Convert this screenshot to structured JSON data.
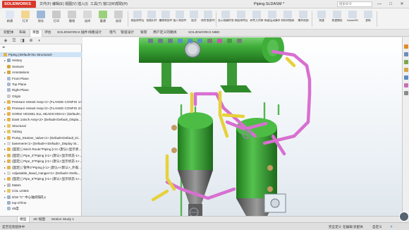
{
  "app": {
    "brand": "SOLIDWORKS",
    "document_title": "Piping.SLDASM *",
    "search_placeholder": "搜索命令",
    "menus": [
      "文件(F)",
      "编辑(E)",
      "视图(V)",
      "插入(I)",
      "工具(T)",
      "窗口(W)",
      "帮助(H)"
    ],
    "window_buttons": [
      "—",
      "□",
      "✕"
    ]
  },
  "ribbon": {
    "buttons": [
      {
        "label": "新建",
        "icon": "new-document-icon",
        "color": "#dfe7f2"
      },
      {
        "label": "打开",
        "icon": "open-folder-icon",
        "color": "#f2d690"
      },
      {
        "label": "保存",
        "icon": "save-icon",
        "color": "#9db7d8"
      },
      {
        "label": "打印",
        "icon": "print-icon",
        "color": "#c9c9c9"
      },
      {
        "label": "撤销",
        "icon": "undo-icon",
        "color": "#cfcfcf"
      },
      {
        "label": "选择",
        "icon": "select-arrow-icon",
        "color": "#d9d9d9"
      },
      {
        "label": "重建",
        "icon": "rebuild-icon",
        "color": "#9bd17c"
      },
      {
        "label": "选项",
        "icon": "gear-icon",
        "color": "#cfcfcf"
      }
    ],
    "left_group": [
      "装配体特征",
      "智能扣件",
      "编辑零部件",
      "插入零部件",
      "配合",
      "线性零部件阵列"
    ],
    "mid_group": [
      "显示隐藏的零部件",
      "装配体特征",
      "参考几何体",
      "新建运动算例",
      "材料明细表",
      "爆炸视图"
    ],
    "right_group": [
      "快速",
      "快速捕捉",
      "Instant3D",
      "更新"
    ]
  },
  "command_tabs": {
    "items": [
      "装配体",
      "布局",
      "草图",
      "评估",
      "SOLIDWORKS 插件",
      "线路设计",
      "电气",
      "管道设计",
      "钣管",
      "用户定义的路线",
      "SOLIDWORKS MBD"
    ],
    "active_index": 2
  },
  "panel_tabs": [
    "◈",
    "☰",
    "◨",
    "⊕",
    "◐"
  ],
  "tree": {
    "filter_icon": "filter-icon",
    "items": [
      {
        "label": "Piping  (Default<No Structural>",
        "level": 0,
        "icon": "assembly-icon",
        "color": "#e5b24a",
        "arrow": "",
        "selected": true
      },
      {
        "label": "History",
        "level": 1,
        "icon": "history-icon",
        "color": "#8fa7c1",
        "arrow": "▸"
      },
      {
        "label": "Sensors",
        "level": 1,
        "icon": "sensor-icon",
        "color": "#d4a640",
        "arrow": ""
      },
      {
        "label": "Annotations",
        "level": 1,
        "icon": "annotation-icon",
        "color": "#d4a640",
        "arrow": "▸"
      },
      {
        "label": "Front Plane",
        "level": 1,
        "icon": "plane-icon",
        "color": "#a8b9d0",
        "arrow": ""
      },
      {
        "label": "Top Plane",
        "level": 1,
        "icon": "plane-icon",
        "color": "#a8b9d0",
        "arrow": ""
      },
      {
        "label": "Right Plane",
        "level": 1,
        "icon": "plane-icon",
        "color": "#a8b9d0",
        "arrow": ""
      },
      {
        "label": "Origin",
        "level": 1,
        "icon": "origin-icon",
        "color": "#c8c8c8",
        "arrow": ""
      },
      {
        "label": "Pressure Vessel Assy<1> (FLANGE CONFIG 1<...",
        "level": 1,
        "icon": "subassembly-icon",
        "color": "#e5b24a",
        "arrow": "▸"
      },
      {
        "label": "Pressure Vessel Assy<2> (FLANGE CONFIG 2<...",
        "level": 1,
        "icon": "subassembly-icon",
        "color": "#e5b24a",
        "arrow": "▸"
      },
      {
        "label": "HORIZ VESSEL ELL HEADS-003<1> (Default<...",
        "level": 1,
        "icon": "subassembly-icon",
        "color": "#e5b24a",
        "arrow": "▸"
      },
      {
        "label": "Davit 14inch Assy<2> (Default<Default_Displa...",
        "level": 1,
        "icon": "subassembly-icon",
        "color": "#e5b24a",
        "arrow": "▸"
      },
      {
        "label": "Structural",
        "level": 1,
        "icon": "folder-icon",
        "color": "#e7c65a",
        "arrow": "▸"
      },
      {
        "label": "Tubing",
        "level": 1,
        "icon": "folder-icon",
        "color": "#e7c65a",
        "arrow": "▸"
      },
      {
        "label": "Pump_Strainer_Valve<1> (Default<Default_Di...",
        "level": 1,
        "icon": "subassembly-icon",
        "color": "#e5b24a",
        "arrow": "▸"
      },
      {
        "label": "basement<1> (Default<<Default>_Display St...",
        "level": 1,
        "icon": "part-icon",
        "color": "#d9d9d9",
        "arrow": "▸"
      },
      {
        "label": "(固定) [ 6inch Route^Piping ]<1> (默认<显示状...",
        "level": 1,
        "icon": "route-icon",
        "color": "#e5b24a",
        "arrow": "▸"
      },
      {
        "label": "(固定) [ Pipe_2^Piping ]<1> (默认<显示状态-1>...",
        "level": 1,
        "icon": "route-icon",
        "color": "#e5b24a",
        "arrow": "▸"
      },
      {
        "label": "(固定) [ Pipe_3^Piping ]<1> (默认<显示状态-1>...",
        "level": 1,
        "icon": "route-icon",
        "color": "#e5b24a",
        "arrow": "▸"
      },
      {
        "label": "(固定) [ 管件2^Piping ]<1> (默认<<默认>_外观...",
        "level": 1,
        "icon": "route-icon",
        "color": "#e5b24a",
        "arrow": "▸"
      },
      {
        "label": "Adjustable_Band_Hanger<1> (Default<<Defa...",
        "level": 1,
        "icon": "part-icon",
        "color": "#d9d9d9",
        "arrow": "▸"
      },
      {
        "label": "(固定) [ Pipe_5^Piping ]<1> (默认<显示状态-1>...",
        "level": 1,
        "icon": "route-icon",
        "color": "#e5b24a",
        "arrow": "▸"
      },
      {
        "label": "Mates",
        "level": 1,
        "icon": "mates-icon",
        "color": "#b7b7b7",
        "arrow": "▸"
      },
      {
        "label": "COL LINES",
        "level": 1,
        "icon": "folder-icon",
        "color": "#e7c65a",
        "arrow": "▸"
      },
      {
        "label": "9/16 \"C\" 中心轴间隔孔1",
        "level": 1,
        "icon": "hole-icon",
        "color": "#9bb0c6",
        "arrow": "▸"
      },
      {
        "label": "top-of-line",
        "level": 1,
        "icon": "sketch-icon",
        "color": "#9bb0c6",
        "arrow": ""
      },
      {
        "label": "45度",
        "level": 1,
        "icon": "plane-icon",
        "color": "#a8b9d0",
        "arrow": ""
      }
    ]
  },
  "hud_icons": [
    "search-icon",
    "zoom-area-icon",
    "previous-view-icon",
    "section-view-icon",
    "view-orientation-icon",
    "display-style-icon",
    "hide-show-icon",
    "appearance-icon",
    "scene-icon",
    "view-settings-icon"
  ],
  "taskpane_icons": [
    "home-icon",
    "resources-icon",
    "design-library-icon",
    "file-explorer-icon",
    "view-palette-icon",
    "appearances-icon",
    "custom-properties-icon"
  ],
  "bottom_tabs": {
    "items": [
      "模型",
      "3D 视图",
      "Motion Study 1"
    ],
    "active_index": 0
  },
  "status": {
    "left": "是否在装配体中",
    "items": [
      "完全定义",
      "在编辑 装配体",
      "自定义"
    ],
    "help_icon": "help-icon"
  },
  "colors": {
    "vessel_green": "#3fae3a",
    "pipe_pink": "#d86fd0",
    "pipe_yellow": "#e6d13c",
    "structure_green": "#5cb85c",
    "brand_red": "#d8372a"
  }
}
